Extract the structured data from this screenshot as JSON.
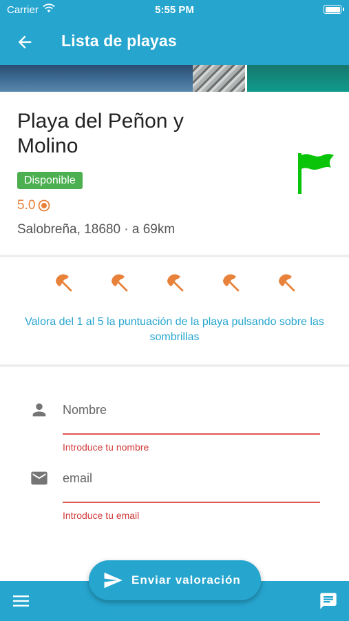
{
  "status_bar": {
    "carrier": "Carrier",
    "time": "5:55 PM"
  },
  "header": {
    "title": "Lista de playas",
    "back_icon": "arrow-back-icon"
  },
  "beach": {
    "name": "Playa del Peñon y Molino",
    "availability": "Disponible",
    "rating": "5.0",
    "location": "Salobreña, 18680 · a 69km",
    "flag_color": "#0ac40a"
  },
  "rating_section": {
    "umbrella_count": 5,
    "umbrella_color": "#e8823a",
    "hint": "Valora del 1 al 5 la puntuación de la playa pulsando sobre las sombrillas"
  },
  "form": {
    "name": {
      "placeholder": "Nombre",
      "value": "",
      "error": "Introduce tu nombre"
    },
    "email": {
      "placeholder": "email",
      "value": "",
      "error": "Introduce tu email"
    }
  },
  "submit": {
    "label": "Enviar valoración"
  },
  "colors": {
    "primary": "#26a5cf",
    "available": "#4caf50",
    "rating": "#e8823a",
    "error": "#d23b3b"
  }
}
